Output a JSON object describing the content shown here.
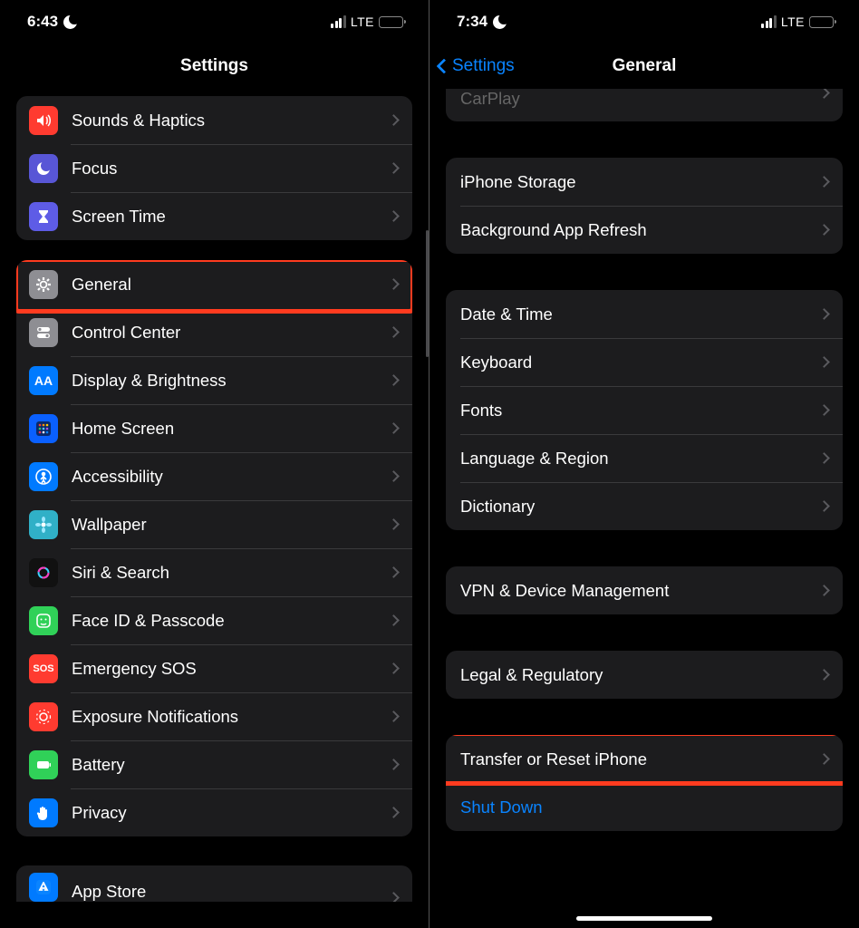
{
  "left": {
    "status": {
      "time": "6:43",
      "network": "LTE"
    },
    "title": "Settings",
    "group1": [
      {
        "name": "sounds-haptics",
        "label": "Sounds & Haptics",
        "iconColor": "i-red",
        "glyph": "volume"
      },
      {
        "name": "focus",
        "label": "Focus",
        "iconColor": "i-purple",
        "glyph": "moon"
      },
      {
        "name": "screen-time",
        "label": "Screen Time",
        "iconColor": "i-indigo",
        "glyph": "hourglass"
      }
    ],
    "group2": [
      {
        "name": "general",
        "label": "General",
        "iconColor": "i-gray",
        "glyph": "gear",
        "highlight": true
      },
      {
        "name": "control-center",
        "label": "Control Center",
        "iconColor": "i-gray",
        "glyph": "switches"
      },
      {
        "name": "display-brightness",
        "label": "Display & Brightness",
        "iconColor": "i-blue",
        "glyph": "AA"
      },
      {
        "name": "home-screen",
        "label": "Home Screen",
        "iconColor": "i-darkblue",
        "glyph": "grid"
      },
      {
        "name": "accessibility",
        "label": "Accessibility",
        "iconColor": "i-blue",
        "glyph": "person"
      },
      {
        "name": "wallpaper",
        "label": "Wallpaper",
        "iconColor": "i-teal",
        "glyph": "flower"
      },
      {
        "name": "siri-search",
        "label": "Siri & Search",
        "iconColor": "i-black",
        "glyph": "siri"
      },
      {
        "name": "faceid-passcode",
        "label": "Face ID & Passcode",
        "iconColor": "i-green",
        "glyph": "face"
      },
      {
        "name": "emergency-sos",
        "label": "Emergency SOS",
        "iconColor": "i-red",
        "glyph": "SOS"
      },
      {
        "name": "exposure-notifications",
        "label": "Exposure Notifications",
        "iconColor": "i-red",
        "glyph": "exposure"
      },
      {
        "name": "battery",
        "label": "Battery",
        "iconColor": "i-green",
        "glyph": "battery"
      },
      {
        "name": "privacy",
        "label": "Privacy",
        "iconColor": "i-blue",
        "glyph": "hand"
      }
    ],
    "group3": [
      {
        "name": "app-store",
        "label": "App Store",
        "iconColor": "i-blue",
        "glyph": "appstore"
      }
    ]
  },
  "right": {
    "status": {
      "time": "7:34",
      "network": "LTE"
    },
    "back": "Settings",
    "title": "General",
    "peek_top": "CarPlay",
    "group1": [
      {
        "name": "iphone-storage",
        "label": "iPhone Storage"
      },
      {
        "name": "background-app-refresh",
        "label": "Background App Refresh"
      }
    ],
    "group2": [
      {
        "name": "date-time",
        "label": "Date & Time"
      },
      {
        "name": "keyboard",
        "label": "Keyboard"
      },
      {
        "name": "fonts",
        "label": "Fonts"
      },
      {
        "name": "language-region",
        "label": "Language & Region"
      },
      {
        "name": "dictionary",
        "label": "Dictionary"
      }
    ],
    "group3": [
      {
        "name": "vpn-device-management",
        "label": "VPN & Device Management"
      }
    ],
    "group4": [
      {
        "name": "legal-regulatory",
        "label": "Legal & Regulatory"
      }
    ],
    "group5": [
      {
        "name": "transfer-reset",
        "label": "Transfer or Reset iPhone",
        "highlight": true
      },
      {
        "name": "shut-down",
        "label": "Shut Down",
        "blue": true,
        "nochev": true
      }
    ]
  }
}
